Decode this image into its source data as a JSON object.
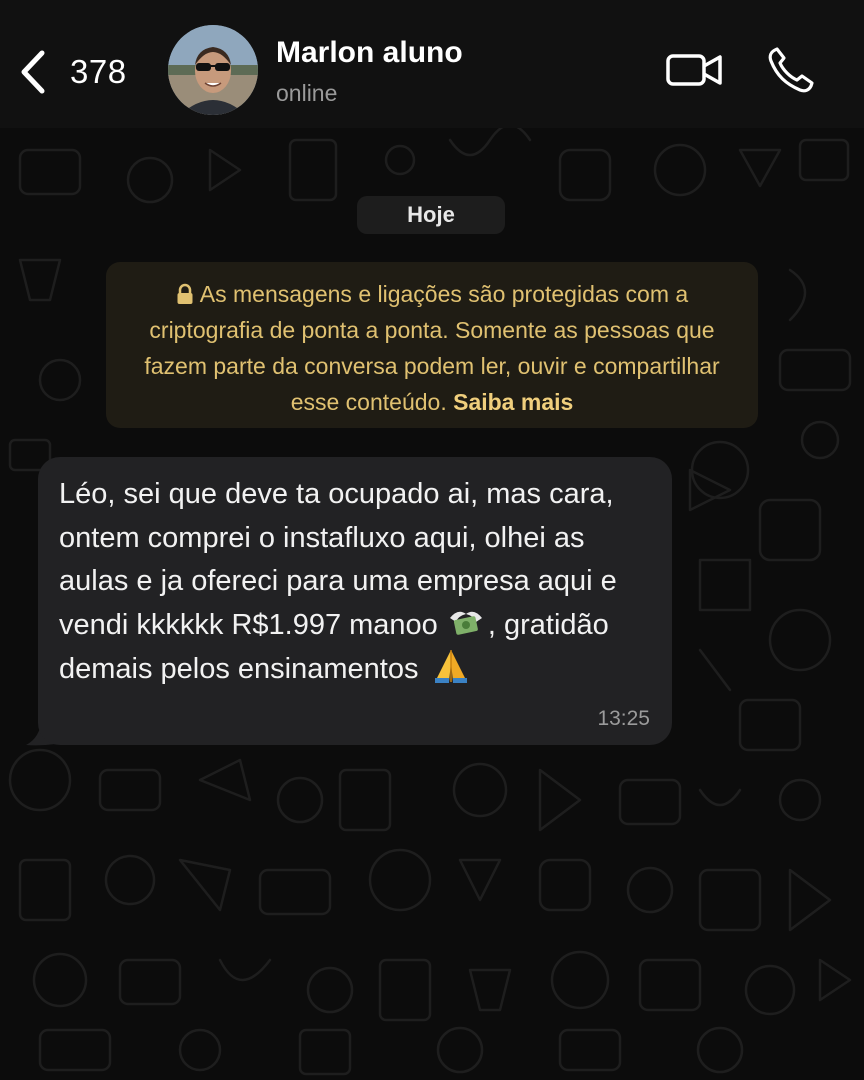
{
  "header": {
    "back_count": "378",
    "contact_name": "Marlon aluno",
    "contact_status": "online",
    "icons": {
      "back": "chevron-left-icon",
      "video": "video-camera-icon",
      "call": "phone-icon"
    }
  },
  "chat": {
    "date_label": "Hoje",
    "encryption_notice": {
      "text": "As mensagens e ligações são protegidas com a criptografia de ponta a ponta. Somente as pessoas que fazem parte da conversa podem ler, ouvir e compartilhar esse conteúdo.",
      "link": "Saiba mais",
      "icon": "lock-icon",
      "color": "#e0c171"
    },
    "messages": [
      {
        "part1": "Léo, sei que deve ta ocupado ai, mas cara, ontem comprei o instafluxo aqui, olhei as aulas e ja ofereci para uma empresa aqui e vendi kkkkkk R$1.997 manoo ",
        "part2": ", gratidão demais pelos ensinamentos ",
        "time": "13:25",
        "emojis": [
          "money-with-wings-icon",
          "folded-hands-icon"
        ]
      }
    ]
  },
  "colors": {
    "background": "#0c0c0c",
    "bubble": "#222224",
    "notice_background": "#1f1c14",
    "secondary_text": "#9a9a9a"
  }
}
